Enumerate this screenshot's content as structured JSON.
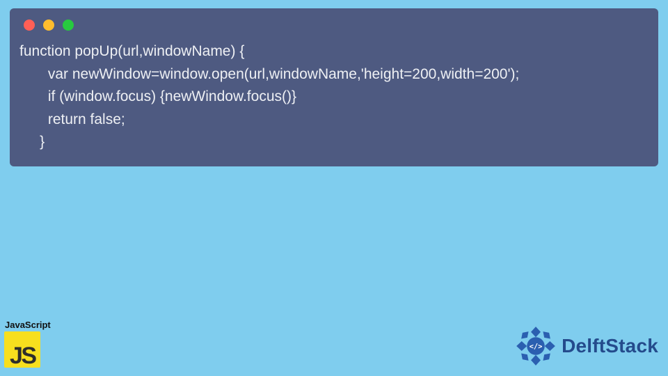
{
  "code": {
    "line1": "function popUp(url,windowName) {",
    "line2": "       var newWindow=window.open(url,windowName,'height=200,width=200');",
    "line3": "       if (window.focus) {newWindow.focus()}",
    "line4": "       return false;",
    "line5": "     }"
  },
  "badge": {
    "label": "JavaScript",
    "logo_j": "J",
    "logo_s": "S"
  },
  "brand": {
    "name": "DelftStack"
  },
  "colors": {
    "background": "#7fcdee",
    "code_bg": "#4e5a81",
    "js_yellow": "#f7df1e",
    "brand_blue": "#244b8c"
  }
}
